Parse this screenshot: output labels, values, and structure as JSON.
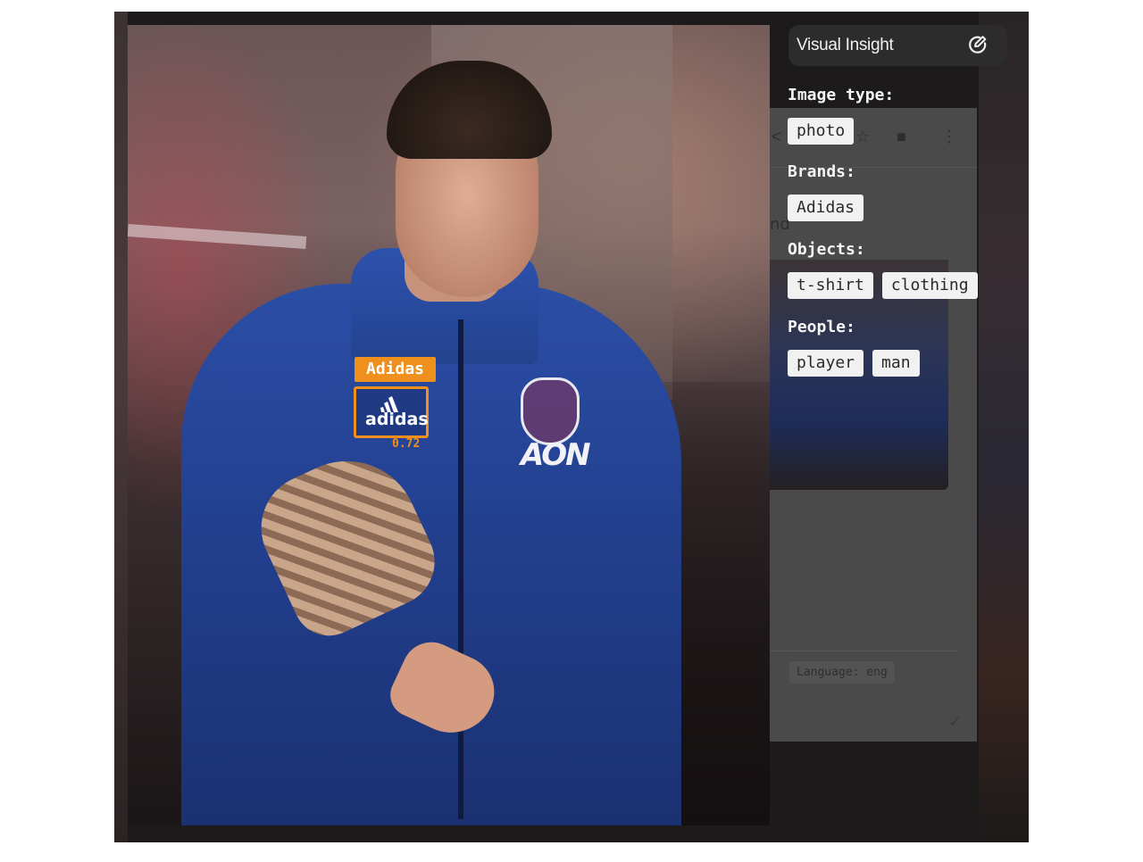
{
  "panel": {
    "title": "Visual Insight",
    "edit_icon": "edit-check-icon",
    "sections": {
      "image_type": {
        "label": "Image type:",
        "tags": [
          "photo"
        ]
      },
      "brands": {
        "label": "Brands:",
        "tags": [
          "Adidas"
        ]
      },
      "objects": {
        "label": "Objects:",
        "tags": [
          "t-shirt",
          "clothing"
        ]
      },
      "people": {
        "label": "People:",
        "tags": [
          "player",
          "man"
        ]
      }
    }
  },
  "detection": {
    "label": "Adidas",
    "logo_text": "adidas",
    "score": "0.72",
    "color": "#f0901c"
  },
  "photo": {
    "sponsor_text": "AON"
  },
  "background_ui": {
    "language": "Language: eng",
    "partial_text": "nd"
  }
}
